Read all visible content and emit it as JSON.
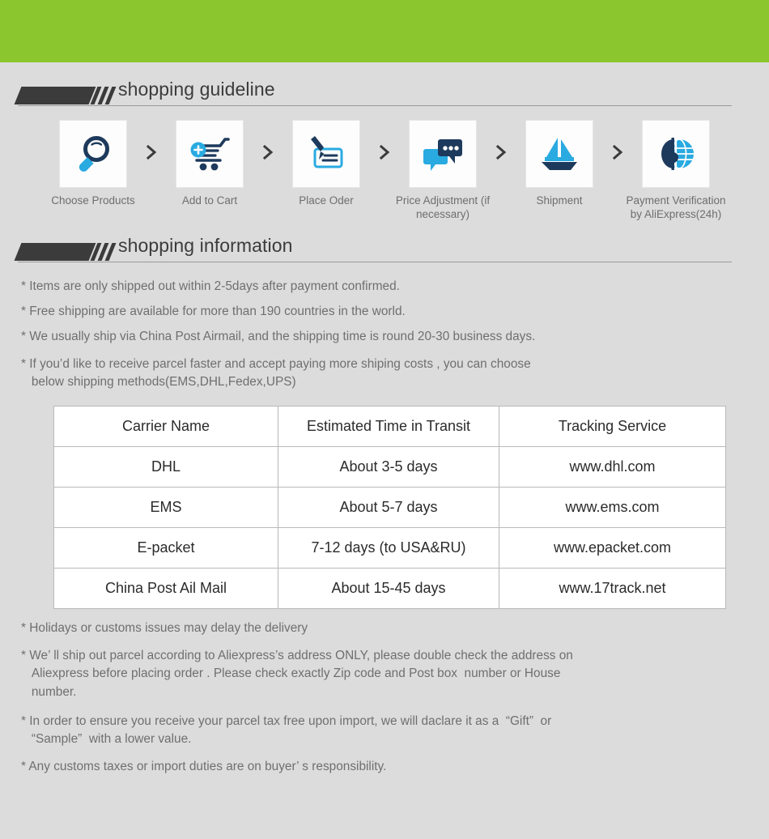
{
  "banner": {
    "accent_color": "#8cc62f",
    "background_color": "#dcdcdc"
  },
  "guideline": {
    "heading": "shopping guideline",
    "steps": [
      {
        "icon": "magnifier-icon",
        "label": "Choose Products"
      },
      {
        "icon": "shopping-cart-plus-icon",
        "label": "Add to Cart"
      },
      {
        "icon": "pen-check-icon",
        "label": "Place Oder"
      },
      {
        "icon": "chat-bubbles-icon",
        "label": "Price Adjustment\n(if necessary)"
      },
      {
        "icon": "sailboat-icon",
        "label": "Shipment"
      },
      {
        "icon": "dollar-globe-icon",
        "label": "Payment Verification\nby AliExpress(24h)"
      }
    ],
    "separator_icon": "chevron-right-icon"
  },
  "information": {
    "heading": "shopping information",
    "lines": [
      "* Items are only shipped out within 2-5days after payment confirmed.",
      "* Free shipping are available for more than 190 countries in the world.",
      "* We usually ship via China Post Airmail, and the shipping time is round 20-30 business days.",
      "* If you’d like to receive parcel faster and accept paying more shiping costs , you can choose\n   below shipping methods(EMS,DHL,Fedex,UPS)"
    ]
  },
  "shipping_table": {
    "headers": [
      "Carrier Name",
      "Estimated Time in Transit",
      "Tracking Service"
    ],
    "rows": [
      [
        "DHL",
        "About 3-5 days",
        "www.dhl.com"
      ],
      [
        "EMS",
        "About 5-7 days",
        "www.ems.com"
      ],
      [
        "E-packet",
        "7-12 days (to USA&RU)",
        "www.epacket.com"
      ],
      [
        "China Post Ail Mail",
        "About 15-45 days",
        "www.17track.net"
      ]
    ]
  },
  "notes": {
    "lines": [
      "* Holidays or customs issues may delay the delivery",
      "* We’ ll ship out parcel according to Aliexpress’s address ONLY, please double check the address on\n   Aliexpress before placing order . Please check exactly Zip code and Post box  number or House\n   number.",
      "* In order to ensure you receive your parcel tax free upon import, we will daclare it as a  “Gift”  or\n   “Sample”  with a lower value.",
      "* Any customs taxes or import duties are on buyer’ s responsibility."
    ]
  }
}
